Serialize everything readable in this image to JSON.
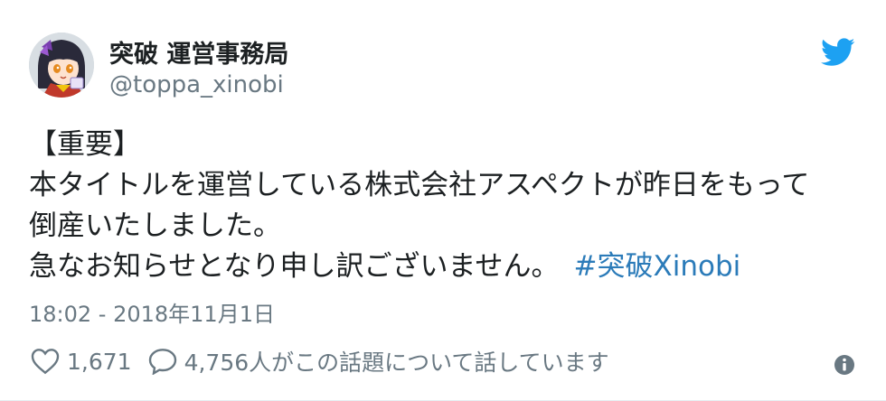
{
  "tweet": {
    "display_name": "突破 運営事務局",
    "handle": "@toppa_xinobi",
    "text_lines": [
      "【重要】",
      "本タイトルを運営している株式会社アスペクトが昨日をもって",
      "倒産いたしました。",
      "急なお知らせとなり申し訳ございません。"
    ],
    "hashtag": "#突破Xinobi",
    "timestamp": "18:02 - 2018年11月1日",
    "like_count": "1,671",
    "conversation_text": "4,756人がこの話題について話しています"
  },
  "icons": {
    "bird": "twitter-bird-icon",
    "like": "heart-icon",
    "reply": "speech-bubble-icon",
    "info": "info-icon"
  },
  "colors": {
    "brand_blue": "#1da1f2",
    "link": "#2b7bb9",
    "muted": "#697882",
    "text": "#1c2022"
  }
}
